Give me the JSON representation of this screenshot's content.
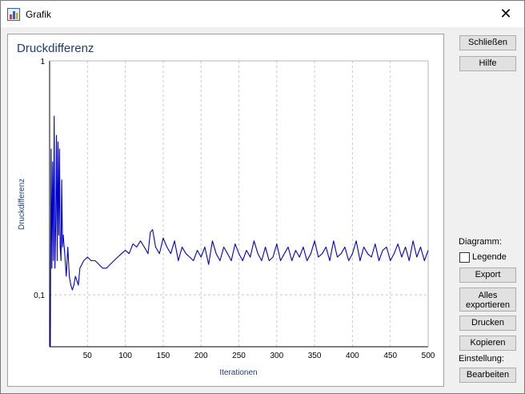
{
  "window": {
    "title": "Grafik",
    "close_glyph": "✕"
  },
  "sidebar": {
    "close_label": "Schließen",
    "help_label": "Hilfe",
    "diagram_label": "Diagramm:",
    "legend_label": "Legende",
    "legend_checked": false,
    "export_label": "Export",
    "export_all_line1": "Alles",
    "export_all_line2": "exportieren",
    "print_label": "Drucken",
    "copy_label": "Kopieren",
    "settings_label": "Einstellung:",
    "edit_label": "Bearbeiten"
  },
  "colors": {
    "series": "#0000cc",
    "title": "#1f3d7a",
    "axis_text": "#1f3d7a",
    "grid": "#c8c8c8"
  },
  "chart_data": {
    "type": "line",
    "title": "Druckdifferenz",
    "xlabel": "Iterationen",
    "ylabel": "Druckdifferenz",
    "xlim": [
      0,
      500
    ],
    "ylim": [
      0.06,
      1
    ],
    "yscale": "log",
    "grid": true,
    "xticks": [
      50,
      100,
      150,
      200,
      250,
      300,
      350,
      400,
      450,
      500
    ],
    "yticks": [
      {
        "value": 0.1,
        "label": "0,1"
      },
      {
        "value": 1,
        "label": "1"
      }
    ],
    "series": [
      {
        "x": [
          1,
          2,
          3,
          4,
          5,
          6,
          7,
          8,
          9,
          10,
          11,
          12,
          13,
          14,
          15,
          16,
          17,
          18,
          20,
          22,
          24,
          26,
          28,
          30,
          32,
          34,
          36,
          38,
          40,
          45,
          50,
          55,
          60,
          65,
          70,
          75,
          80,
          85,
          90,
          95,
          100,
          105,
          110,
          115,
          120,
          125,
          130,
          133,
          136,
          140,
          145,
          150,
          155,
          160,
          165,
          170,
          175,
          180,
          185,
          190,
          195,
          200,
          205,
          210,
          215,
          220,
          225,
          230,
          235,
          240,
          245,
          250,
          255,
          260,
          265,
          270,
          275,
          280,
          285,
          290,
          295,
          300,
          305,
          310,
          315,
          320,
          325,
          330,
          335,
          340,
          345,
          350,
          355,
          360,
          365,
          370,
          375,
          380,
          385,
          390,
          395,
          400,
          405,
          410,
          415,
          420,
          425,
          430,
          435,
          440,
          445,
          450,
          455,
          460,
          465,
          470,
          475,
          480,
          485,
          490,
          495,
          500
        ],
        "values": [
          0.06,
          0.42,
          0.13,
          0.37,
          0.14,
          0.58,
          0.13,
          0.2,
          0.48,
          0.14,
          0.45,
          0.18,
          0.42,
          0.16,
          0.14,
          0.31,
          0.16,
          0.18,
          0.15,
          0.12,
          0.16,
          0.12,
          0.11,
          0.105,
          0.11,
          0.12,
          0.115,
          0.11,
          0.13,
          0.14,
          0.145,
          0.14,
          0.14,
          0.135,
          0.13,
          0.13,
          0.135,
          0.14,
          0.145,
          0.15,
          0.155,
          0.15,
          0.165,
          0.16,
          0.17,
          0.16,
          0.15,
          0.185,
          0.19,
          0.16,
          0.15,
          0.175,
          0.16,
          0.15,
          0.17,
          0.14,
          0.16,
          0.15,
          0.145,
          0.14,
          0.155,
          0.145,
          0.16,
          0.135,
          0.17,
          0.15,
          0.14,
          0.16,
          0.15,
          0.14,
          0.165,
          0.15,
          0.14,
          0.155,
          0.145,
          0.17,
          0.15,
          0.14,
          0.16,
          0.14,
          0.145,
          0.165,
          0.14,
          0.15,
          0.16,
          0.14,
          0.155,
          0.145,
          0.16,
          0.14,
          0.15,
          0.17,
          0.145,
          0.15,
          0.16,
          0.14,
          0.17,
          0.145,
          0.15,
          0.16,
          0.14,
          0.15,
          0.17,
          0.14,
          0.16,
          0.15,
          0.145,
          0.165,
          0.14,
          0.155,
          0.16,
          0.14,
          0.15,
          0.165,
          0.145,
          0.16,
          0.14,
          0.17,
          0.145,
          0.16,
          0.14,
          0.155
        ]
      }
    ]
  }
}
